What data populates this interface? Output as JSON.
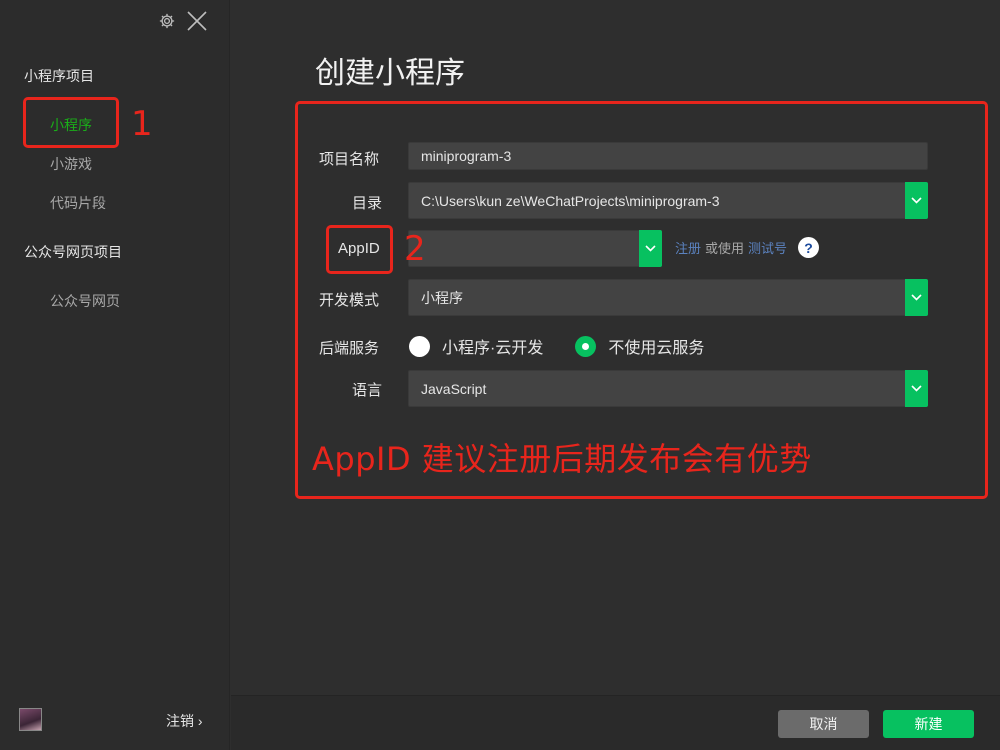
{
  "sidebar": {
    "section_miniprogram": "小程序项目",
    "items_miniprogram": [
      "小程序",
      "小游戏",
      "代码片段"
    ],
    "section_officialaccount": "公众号网页项目",
    "items_officialaccount": [
      "公众号网页"
    ],
    "logout_label": "注销 ›"
  },
  "annotations": {
    "num1": "1",
    "num2": "2",
    "hint": "AppID 建议注册后期发布会有优势"
  },
  "main": {
    "title": "创建小程序",
    "form": {
      "project_name_label": "项目名称",
      "project_name_value": "miniprogram-3",
      "directory_label": "目录",
      "directory_value": "C:\\Users\\kun ze\\WeChatProjects\\miniprogram-3",
      "appid_label": "AppID",
      "appid_value": "",
      "appid_register_link": "注册",
      "appid_or_use": "或使用",
      "appid_test_link": "测试号",
      "help_glyph": "?",
      "dev_mode_label": "开发模式",
      "dev_mode_value": "小程序",
      "backend_label": "后端服务",
      "backend_option_cloud": "小程序·云开发",
      "backend_option_none": "不使用云服务",
      "backend_selected": "不使用云服务",
      "language_label": "语言",
      "language_value": "JavaScript"
    },
    "buttons": {
      "cancel": "取消",
      "create": "新建"
    }
  },
  "colors": {
    "accent_green": "#07c160",
    "annotation_red": "#e8251c",
    "link_blue": "#5b82bf"
  }
}
